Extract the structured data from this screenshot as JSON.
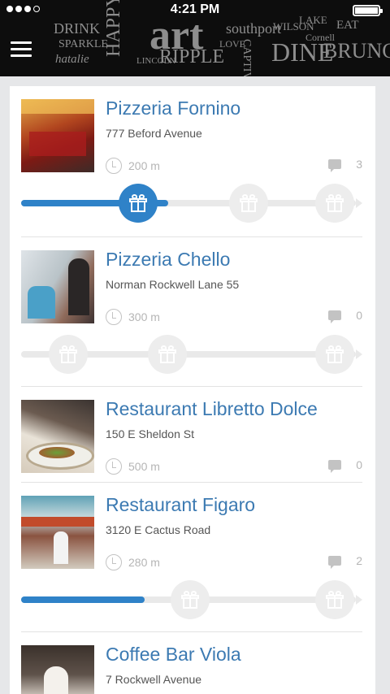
{
  "status_bar": {
    "time": "4:21 PM"
  },
  "header": {
    "banner_words": [
      "DRINK",
      "SPARKLE",
      "hatalie",
      "HAPPY",
      "LINCOLN",
      "art",
      "RIPPLE",
      "southport",
      "LOVE",
      "CAPTIVATE",
      "DINE",
      "WILSON",
      "LAKE",
      "BRUNCH",
      "EAT",
      "Cornell"
    ]
  },
  "venues": [
    {
      "name": "Pizzeria Fornino",
      "address": "777 Beford Avenue",
      "distance": "200 m",
      "comments": "3",
      "progress": 0.44,
      "rewards_active": [
        true,
        false,
        false
      ]
    },
    {
      "name": "Pizzeria Chello",
      "address": "Norman Rockwell Lane 55",
      "distance": "300 m",
      "comments": "0",
      "progress": 0,
      "rewards_active": [
        false,
        false,
        false
      ]
    },
    {
      "name": "Restaurant Libretto Dolce",
      "address": "150 E Sheldon St",
      "distance": "500 m",
      "comments": "0"
    },
    {
      "name": "Restaurant Figaro",
      "address": "3120 E Cactus Road",
      "distance": "280 m",
      "comments": "2",
      "progress": 0.37,
      "rewards_active": [
        false,
        false
      ]
    },
    {
      "name": "Coffee Bar Viola",
      "address": "7 Rockwell Avenue"
    }
  ],
  "colors": {
    "accent": "#2f82c8",
    "title": "#3c7ab2",
    "header_bg": "#0d0d0d",
    "page_bg": "#e6e7e9",
    "muted": "#b5b5b5"
  },
  "icons": {
    "menu": "hamburger-menu-icon",
    "distance": "clock-icon",
    "comments": "chat-bubble-icon",
    "reward": "gift-icon"
  }
}
